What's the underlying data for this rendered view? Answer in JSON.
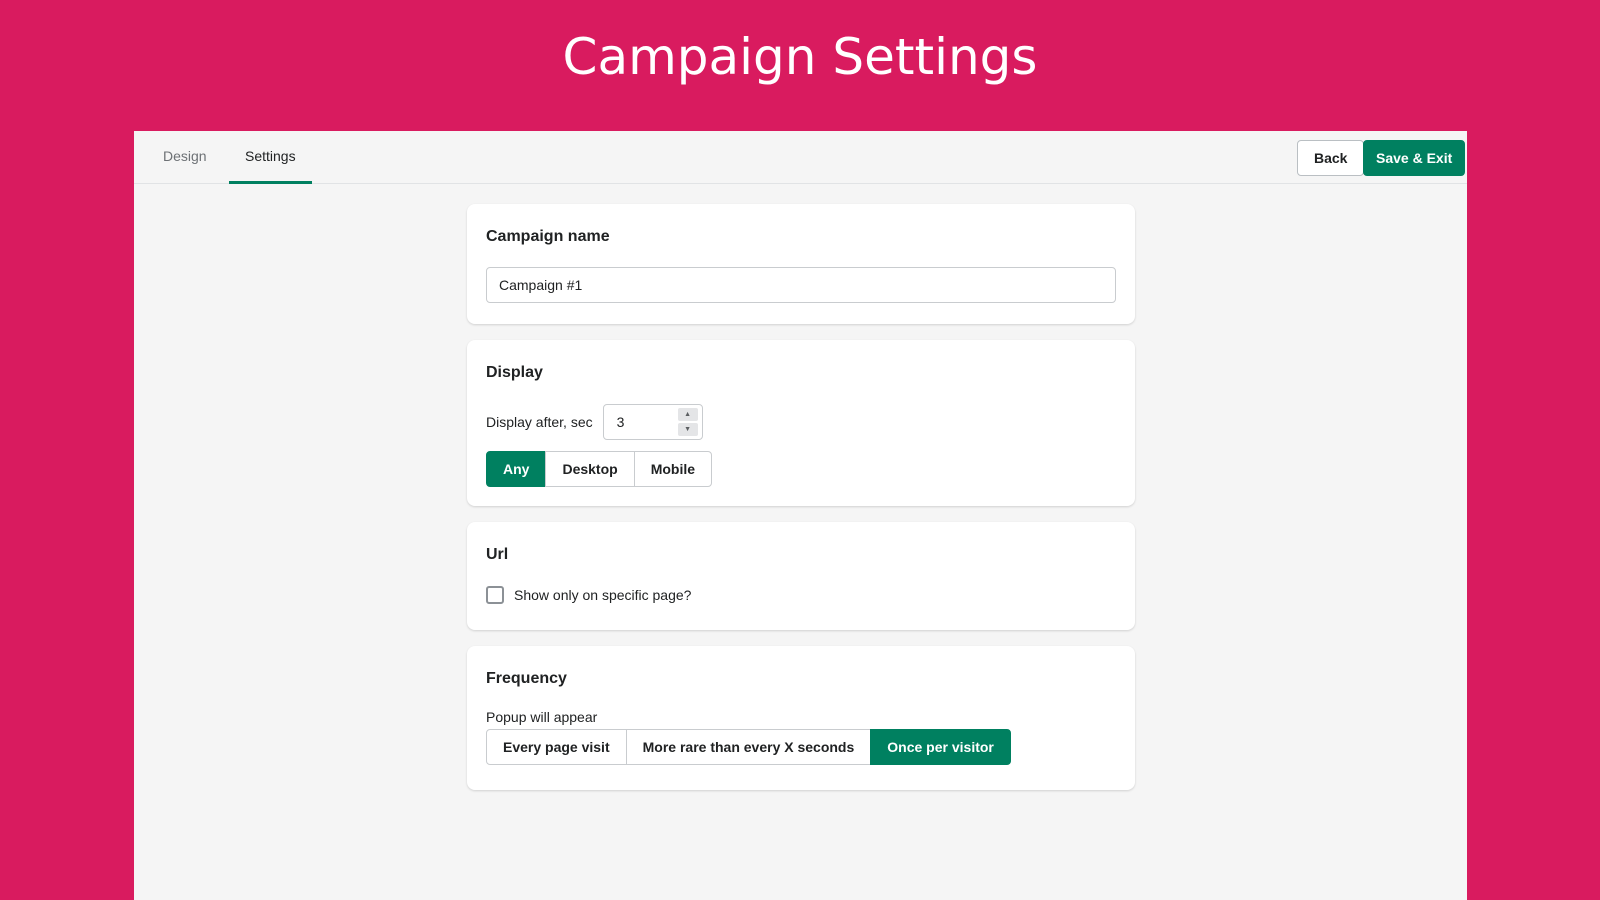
{
  "header": {
    "title": "Campaign Settings"
  },
  "tabs": [
    {
      "label": "Design",
      "active": false
    },
    {
      "label": "Settings",
      "active": true
    }
  ],
  "toolbar": {
    "back_label": "Back",
    "save_label": "Save & Exit"
  },
  "campaign_name": {
    "heading": "Campaign name",
    "value": "Campaign #1"
  },
  "display": {
    "heading": "Display",
    "delay_label": "Display after, sec",
    "delay_value": "3",
    "devices": [
      "Any",
      "Desktop",
      "Mobile"
    ],
    "selected_device": "Any"
  },
  "url": {
    "heading": "Url",
    "checkbox_label": "Show only on specific page?",
    "checked": false
  },
  "frequency": {
    "heading": "Frequency",
    "label": "Popup will appear",
    "options": [
      "Every page visit",
      "More rare than every X seconds",
      "Once per visitor"
    ],
    "selected": "Once per visitor"
  },
  "colors": {
    "background": "#d91b5f",
    "accent": "#008060"
  }
}
